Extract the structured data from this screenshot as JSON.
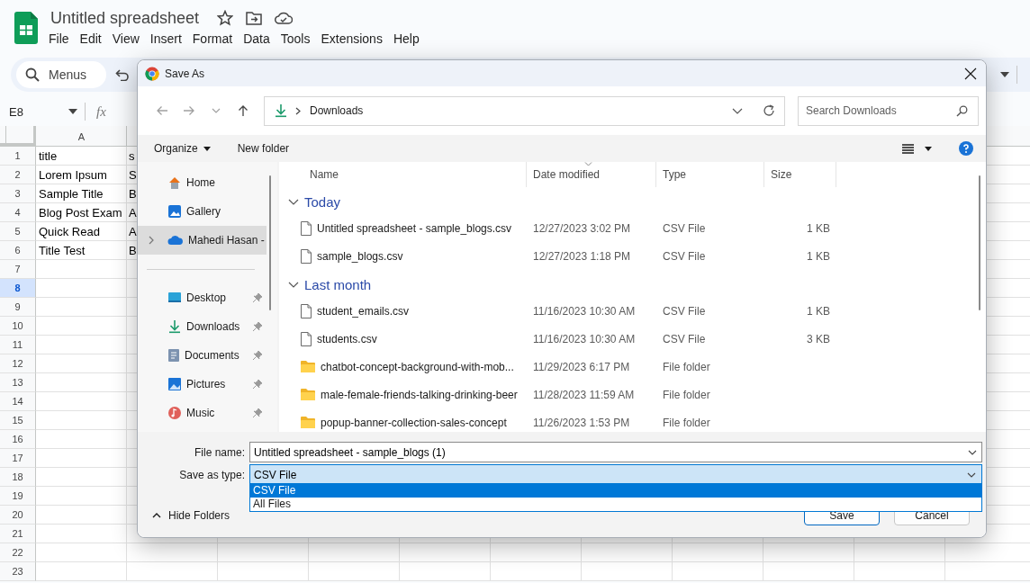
{
  "app": {
    "title": "Untitled spreadsheet",
    "menu": [
      "File",
      "Edit",
      "View",
      "Insert",
      "Format",
      "Data",
      "Tools",
      "Extensions",
      "Help"
    ],
    "menus_button": "Menus"
  },
  "formula_bar": {
    "cell_ref": "E8",
    "function_label": "fx"
  },
  "sheet": {
    "columns": [
      "A"
    ],
    "rows": [
      {
        "number": "1",
        "selected": false,
        "cells": [
          "title",
          "s"
        ]
      },
      {
        "number": "2",
        "selected": false,
        "cells": [
          "Lorem Ipsum",
          "S"
        ]
      },
      {
        "number": "3",
        "selected": false,
        "cells": [
          "Sample Title",
          "B"
        ]
      },
      {
        "number": "4",
        "selected": false,
        "cells": [
          "Blog Post Exam",
          "A"
        ]
      },
      {
        "number": "5",
        "selected": false,
        "cells": [
          "Quick Read",
          "A"
        ]
      },
      {
        "number": "6",
        "selected": false,
        "cells": [
          "Title Test",
          "B"
        ]
      },
      {
        "number": "7",
        "selected": false
      },
      {
        "number": "8",
        "selected": true
      },
      {
        "number": "9",
        "selected": false
      },
      {
        "number": "10",
        "selected": false
      },
      {
        "number": "11",
        "selected": false
      },
      {
        "number": "12",
        "selected": false
      },
      {
        "number": "13",
        "selected": false
      },
      {
        "number": "14",
        "selected": false
      },
      {
        "number": "15",
        "selected": false
      },
      {
        "number": "16",
        "selected": false
      },
      {
        "number": "17",
        "selected": false
      },
      {
        "number": "18",
        "selected": false
      },
      {
        "number": "19",
        "selected": false
      },
      {
        "number": "20",
        "selected": false
      },
      {
        "number": "21",
        "selected": false
      },
      {
        "number": "22",
        "selected": false
      },
      {
        "number": "23",
        "selected": false
      }
    ]
  },
  "dialog": {
    "title": "Save As",
    "address": "Downloads",
    "search_placeholder": "Search Downloads",
    "commands": {
      "organize": "Organize",
      "new_folder": "New folder"
    },
    "nav": [
      {
        "label": "Home",
        "selected": false,
        "expandable": false
      },
      {
        "label": "Gallery",
        "selected": false,
        "expandable": false
      },
      {
        "label": "Mahedi Hasan -",
        "selected": true,
        "expandable": true
      }
    ],
    "quick_access": [
      {
        "label": "Desktop",
        "selected": false,
        "pinned": true
      },
      {
        "label": "Downloads",
        "selected": false,
        "pinned": true
      },
      {
        "label": "Documents",
        "selected": false,
        "pinned": true
      },
      {
        "label": "Pictures",
        "selected": false,
        "pinned": true
      },
      {
        "label": "Music",
        "selected": false,
        "pinned": true
      }
    ],
    "columns": [
      {
        "label": "Name",
        "sorted": false
      },
      {
        "label": "Date modified",
        "sorted": true
      },
      {
        "label": "Type",
        "sorted": false
      },
      {
        "label": "Size",
        "sorted": false
      }
    ],
    "groups": [
      {
        "label": "Today",
        "expanded": true,
        "children": [
          {
            "name": "Untitled spreadsheet - sample_blogs.csv",
            "date": "12/27/2023 3:02 PM",
            "type": "CSV File",
            "size": "1 KB",
            "kind": "file"
          },
          {
            "name": "sample_blogs.csv",
            "date": "12/27/2023 1:18 PM",
            "type": "CSV File",
            "size": "1 KB",
            "kind": "file"
          }
        ]
      },
      {
        "label": "Last month",
        "expanded": true,
        "children": [
          {
            "name": "student_emails.csv",
            "date": "11/16/2023 10:30 AM",
            "type": "CSV File",
            "size": "1 KB",
            "kind": "file"
          },
          {
            "name": "students.csv",
            "date": "11/16/2023 10:30 AM",
            "type": "CSV File",
            "size": "3 KB",
            "kind": "file"
          },
          {
            "name": "chatbot-concept-background-with-mob...",
            "date": "11/29/2023 6:17 PM",
            "type": "File folder",
            "kind": "folder"
          },
          {
            "name": "male-female-friends-talking-drinking-beer",
            "date": "11/28/2023 11:59 AM",
            "type": "File folder",
            "kind": "folder"
          },
          {
            "name": "popup-banner-collection-sales-concept",
            "date": "11/26/2023 1:53 PM",
            "type": "File folder",
            "kind": "folder"
          }
        ]
      }
    ],
    "file_name": {
      "label": "File name:",
      "value": "Untitled spreadsheet - sample_blogs (1)"
    },
    "save_type": {
      "label": "Save as type:",
      "value": "CSV File",
      "expanded": true,
      "options": [
        {
          "label": "CSV File",
          "selected": true
        },
        {
          "label": "All Files",
          "selected": false
        }
      ]
    },
    "hide_folders": "Hide Folders",
    "buttons": [
      "Save",
      "Cancel"
    ]
  }
}
